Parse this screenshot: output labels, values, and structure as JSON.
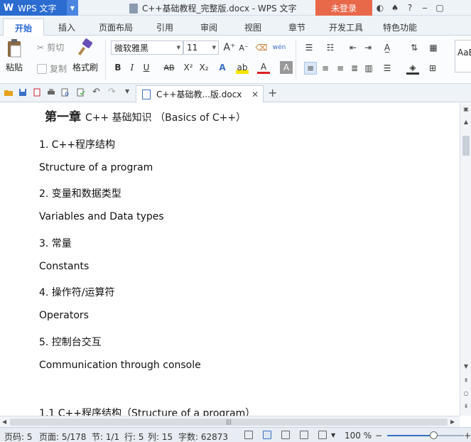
{
  "titlebar": {
    "app_name": "WPS 文字",
    "logo": "W",
    "document_title": "C++基础教程_完整版.docx - WPS 文字",
    "login_label": "未登录",
    "icons": [
      "theme-icon",
      "shirt-icon",
      "help-icon",
      "minimize-icon"
    ]
  },
  "menu": {
    "tabs": [
      "开始",
      "插入",
      "页面布局",
      "引用",
      "审阅",
      "视图",
      "章节",
      "开发工具",
      "特色功能"
    ],
    "active": "开始"
  },
  "ribbon": {
    "paste_label": "粘贴",
    "cut_label": "剪切",
    "copy_label": "复制",
    "format_painter_label": "格式刷",
    "font_name": "微软雅黑",
    "font_size": "11",
    "style_preview": "AaB"
  },
  "doc_tab": {
    "label": "C++基础教...版.docx"
  },
  "document": {
    "heading_chapter": "第一章",
    "heading_rest": "C++ 基础知识 （Basics of C++）",
    "paragraphs": [
      "1. C++程序结构",
      "Structure of a program",
      "2. 变量和数据类型",
      "Variables and Data types",
      "3. 常量",
      "Constants",
      "4. 操作符/运算符",
      "Operators",
      "5. 控制台交互",
      "Communication through console",
      "1.1 C++程序结构（Structure of a program）"
    ]
  },
  "status": {
    "page_code": "页码: 5",
    "page": "页面: 5/178",
    "section": "节: 1/1",
    "row": "行: 5",
    "col": "列: 15",
    "word_count": "字数: 62873",
    "zoom": "100 %",
    "zoom_fraction": 0.6
  },
  "colors": {
    "accent": "#2b6cd0",
    "login": "#e8684a"
  }
}
